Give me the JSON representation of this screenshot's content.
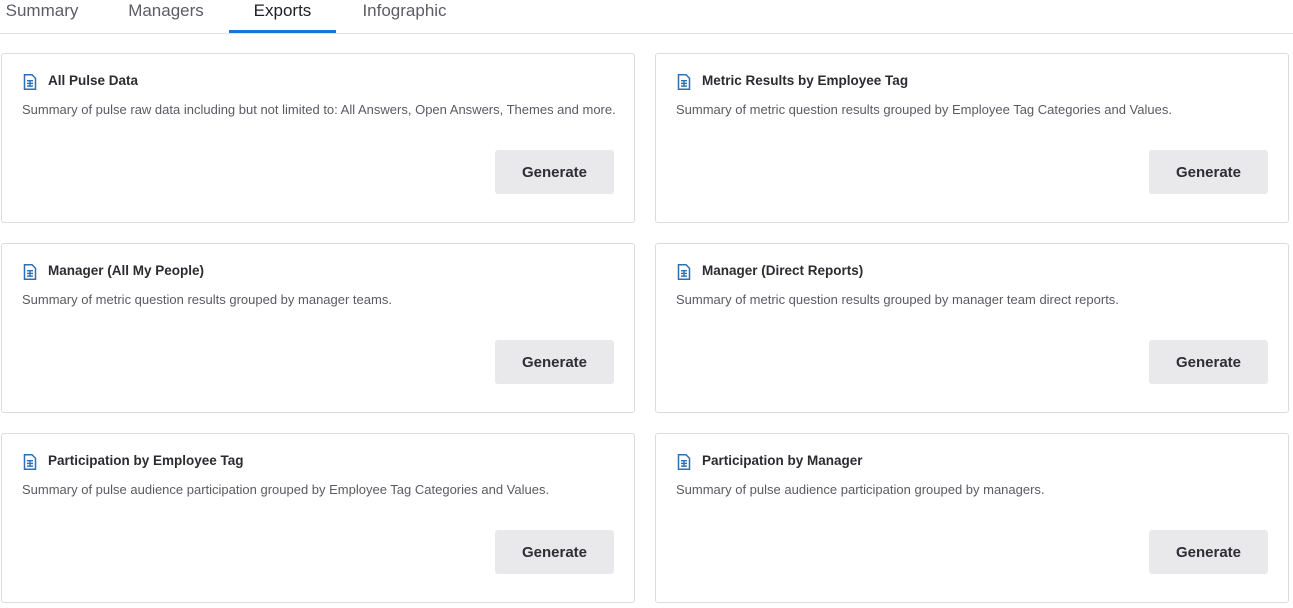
{
  "tabs": [
    {
      "label": "Summary",
      "active": false
    },
    {
      "label": "Managers",
      "active": false
    },
    {
      "label": "Exports",
      "active": true
    },
    {
      "label": "Infographic",
      "active": false
    }
  ],
  "colors": {
    "accent": "#1a73d9",
    "icon": "#2f6fb3",
    "button_bg": "#e9e9ec"
  },
  "exports": [
    {
      "title": "All Pulse Data",
      "description": "Summary of pulse raw data including but not limited to: All Answers, Open Answers, Themes and more.",
      "button_label": "Generate",
      "icon": "document-icon"
    },
    {
      "title": "Metric Results by Employee Tag",
      "description": "Summary of metric question results grouped by Employee Tag Categories and Values.",
      "button_label": "Generate",
      "icon": "document-icon"
    },
    {
      "title": "Manager (All My People)",
      "description": "Summary of metric question results grouped by manager teams.",
      "button_label": "Generate",
      "icon": "document-icon"
    },
    {
      "title": "Manager (Direct Reports)",
      "description": "Summary of metric question results grouped by manager team direct reports.",
      "button_label": "Generate",
      "icon": "document-icon"
    },
    {
      "title": "Participation by Employee Tag",
      "description": "Summary of pulse audience participation grouped by Employee Tag Categories and Values.",
      "button_label": "Generate",
      "icon": "document-icon"
    },
    {
      "title": "Participation by Manager",
      "description": "Summary of pulse audience participation grouped by managers.",
      "button_label": "Generate",
      "icon": "document-icon"
    }
  ]
}
